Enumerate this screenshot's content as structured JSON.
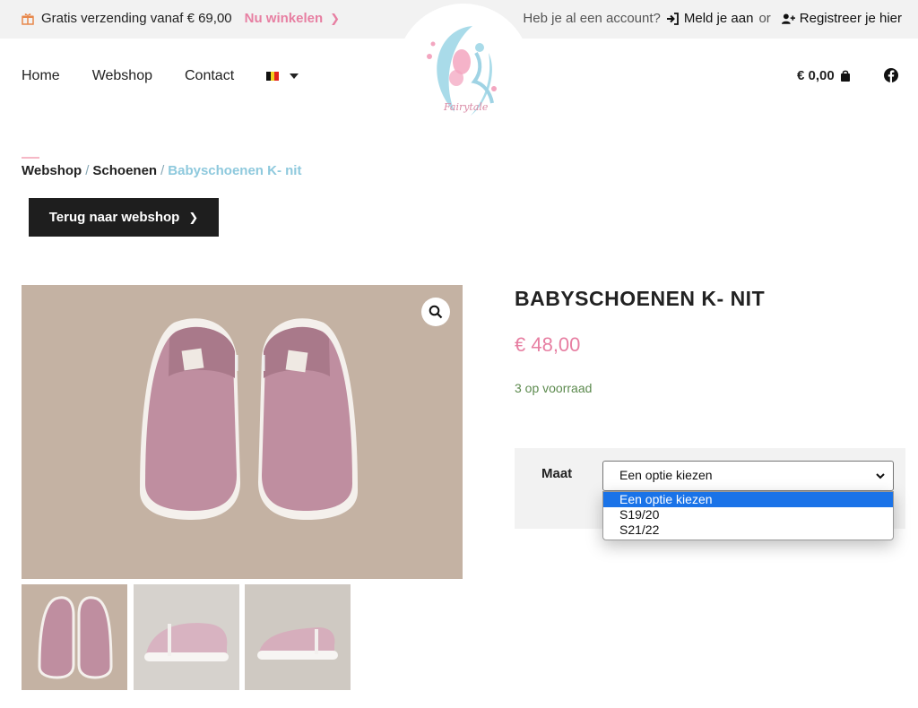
{
  "topbar": {
    "shipping_text": "Gratis verzending vanaf € 69,00",
    "shop_link": "Nu winkelen",
    "account_question": "Heb je al een account?",
    "login": "Meld je aan",
    "or": "or",
    "register": "Registreer je hier"
  },
  "logo": {
    "text": "Fairytale"
  },
  "nav": {
    "items": [
      "Home",
      "Webshop",
      "Contact"
    ],
    "cart_total": "€ 0,00"
  },
  "breadcrumb": {
    "items": [
      "Webshop",
      "Schoenen"
    ],
    "current": "Babyschoenen K- nit",
    "separator": "/"
  },
  "back_button": "Terug naar webshop",
  "product": {
    "title": "BABYSCHOENEN K- NIT",
    "price": "€ 48,00",
    "stock": "3 op voorraad",
    "variation_label": "Maat",
    "select_value": "Een optie kiezen",
    "options": [
      "Een optie kiezen",
      "S19/20",
      "S21/22"
    ]
  },
  "colors": {
    "accent_pink": "#e77fa2",
    "accent_blue": "#8ec9dd",
    "stock_green": "#5c8a4e",
    "button_dark": "#1e1e1e"
  }
}
